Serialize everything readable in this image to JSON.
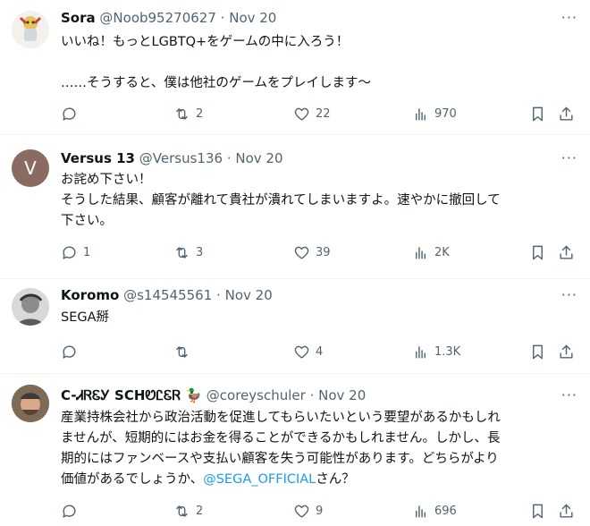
{
  "tweets": [
    {
      "name": "Sora",
      "handle": "@Noob95270627",
      "dot": "·",
      "time": "Nov 20",
      "text": "いいね！もっとLGBTQ+をゲームの中に入ろう！\n\n……そうすると、僕は他社のゲームをプレイします〜",
      "link": "",
      "text_suffix": "",
      "replies": "",
      "retweets": "2",
      "likes": "22",
      "views": "970"
    },
    {
      "name": "Versus 13",
      "handle": "@Versus136",
      "dot": "·",
      "time": "Nov 20",
      "avatar_letter": "V",
      "text": "お詫め下さい！\nそうした結果、顧客が離れて貴社が潰れてしまいますよ。速やかに撤回して\n下さい。",
      "link": "",
      "text_suffix": "",
      "replies": "1",
      "retweets": "3",
      "likes": "39",
      "views": "2K"
    },
    {
      "name": "Koromo",
      "handle": "@s14545561",
      "dot": "·",
      "time": "Nov 20",
      "text": "SEGA掰",
      "link": "",
      "text_suffix": "",
      "replies": "",
      "retweets": "",
      "likes": "4",
      "views": "1.3K"
    },
    {
      "name": "C-ᏗᏒᏋᎩ SCHᏬᏝᏋᏒ 🦆",
      "handle": "@coreyschuler",
      "dot": "·",
      "time": "Nov 20",
      "text": "産業持株会社から政治活動を促進してもらいたいという要望があるかもしれ\nませんが、短期的にはお金を得ることができるかもしれません。しかし、長\n期的にはファンベースや支払い顧客を失う可能性があります。どちらがより\n価値があるでしょうか、",
      "link": "@SEGA_OFFICIAL",
      "text_suffix": "さん？",
      "replies": "",
      "retweets": "2",
      "likes": "9",
      "views": "696"
    }
  ],
  "more_label": "···",
  "colors": {
    "link": "#1d9bf0",
    "muted": "#536471",
    "divider": "#eff3f4"
  }
}
